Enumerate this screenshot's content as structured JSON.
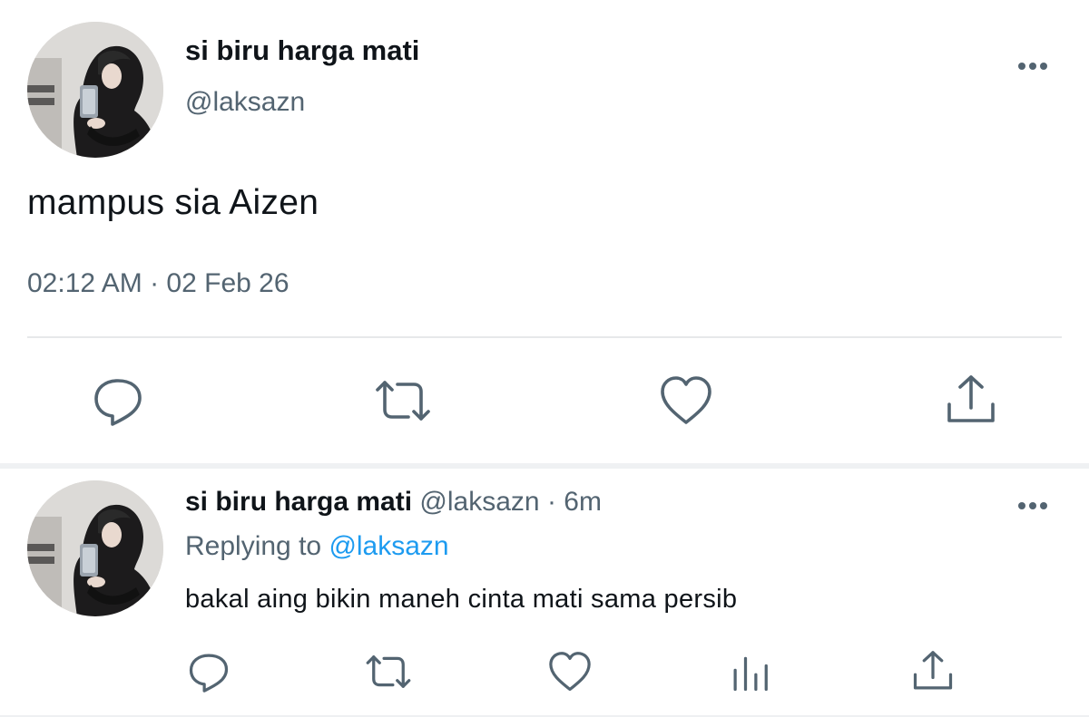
{
  "tweet": {
    "author_name": "si biru harga mati",
    "author_handle": "@laksazn",
    "text": "mampus sia Aizen",
    "timestamp": "02:12 AM · 02 Feb 26",
    "actions": [
      "reply-icon",
      "retweet-icon",
      "like-icon",
      "share-icon"
    ],
    "more_icon": "more-horizontal-icon"
  },
  "reply": {
    "author_name": "si biru harga mati",
    "author_handle": "@laksazn",
    "time": "· 6m",
    "replying_label": "Replying to",
    "replying_mention": "@laksazn",
    "text": "bakal aing bikin maneh cinta mati sama persib",
    "actions": [
      "reply-icon",
      "retweet-icon",
      "like-icon",
      "analytics-icon",
      "share-icon"
    ],
    "more_icon": "more-horizontal-icon"
  },
  "colors": {
    "text_primary": "#0f1419",
    "text_secondary": "#536471",
    "icon": "#536471",
    "accent": "#1d9bf0",
    "divider": "#e6e8ea"
  }
}
